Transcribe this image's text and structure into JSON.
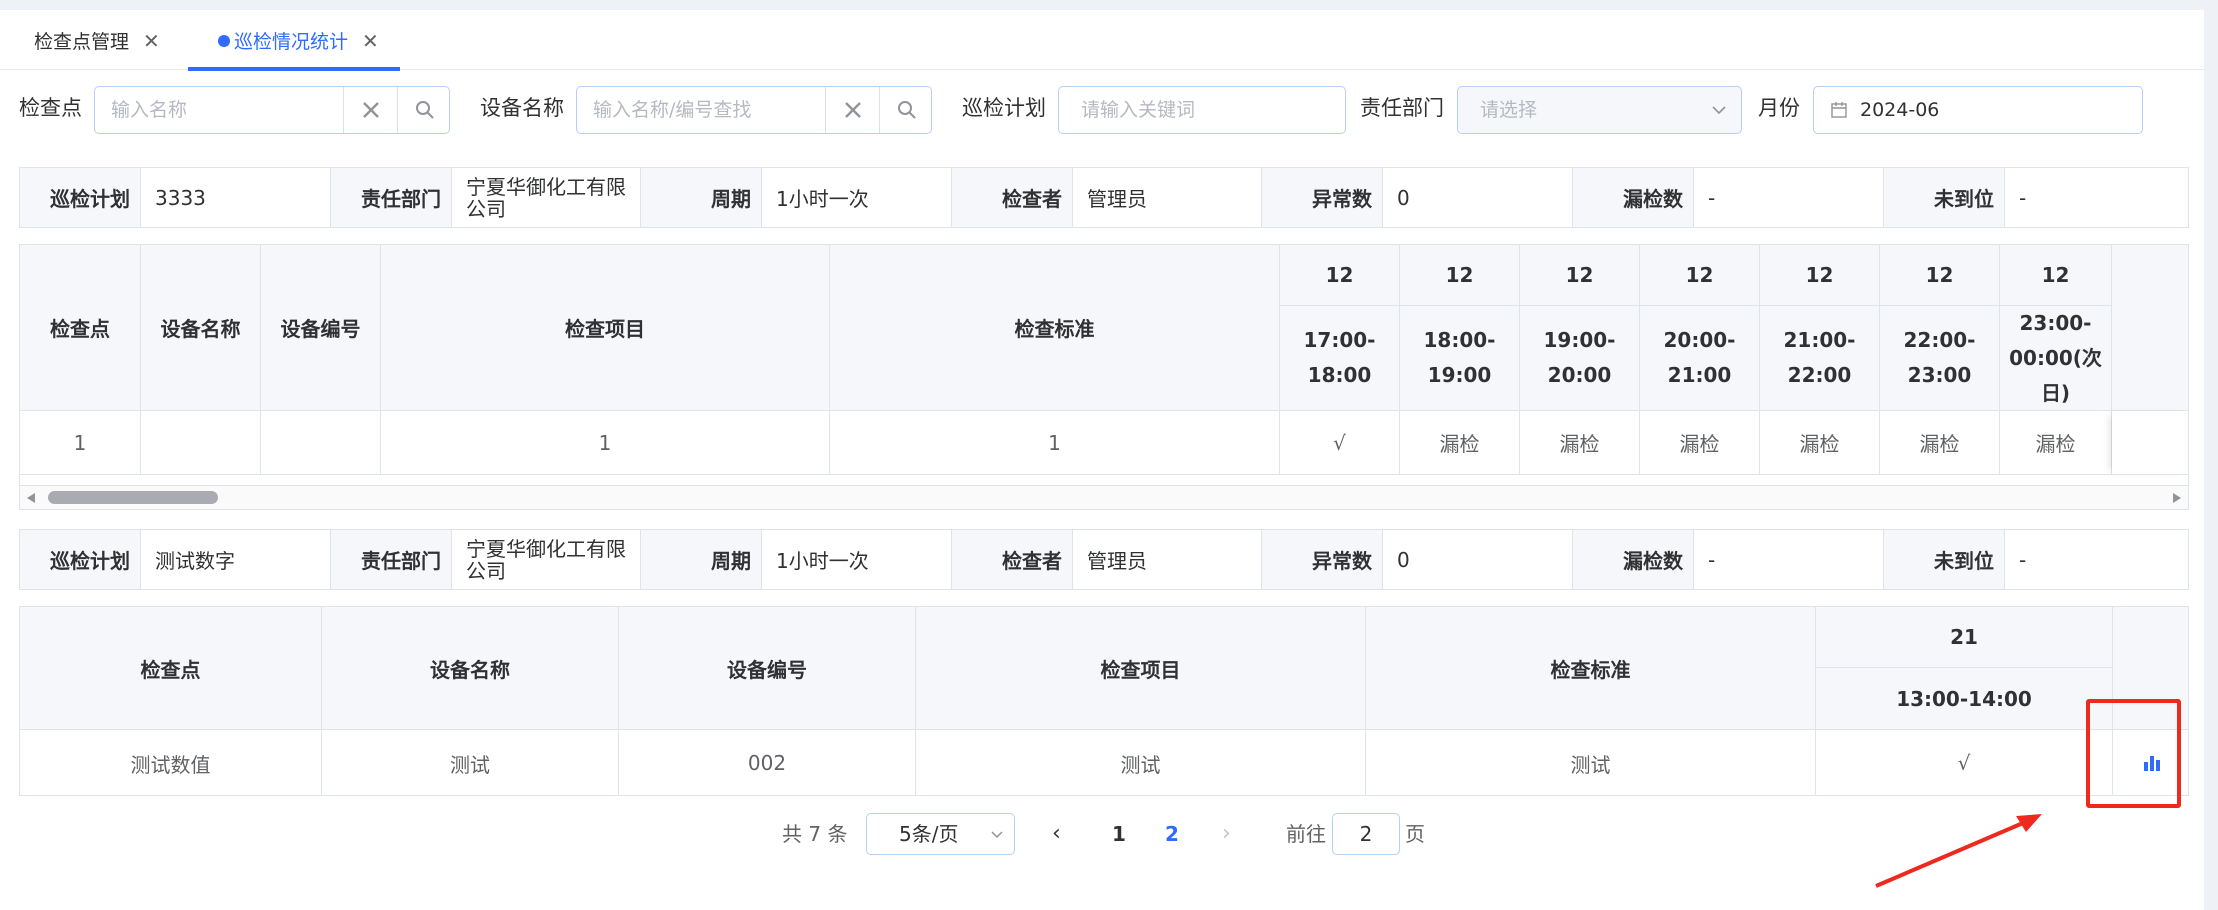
{
  "tabs": [
    {
      "label": "检查点管理",
      "active": false
    },
    {
      "label": "巡检情况统计",
      "active": true
    }
  ],
  "filters": {
    "checkpoint": {
      "label": "检查点",
      "placeholder": "输入名称"
    },
    "device": {
      "label": "设备名称",
      "placeholder": "输入名称/编号查找"
    },
    "plan": {
      "label": "巡检计划",
      "placeholder": "请输入关键词"
    },
    "dept": {
      "label": "责任部门",
      "placeholder": "请选择"
    },
    "month": {
      "label": "月份",
      "value": "2024-06"
    }
  },
  "info_labels": {
    "plan": "巡检计划",
    "dept": "责任部门",
    "period": "周期",
    "inspector": "检查者",
    "abnormal": "异常数",
    "missed": "漏检数",
    "absent": "未到位"
  },
  "plans": [
    {
      "plan": "3333",
      "dept": "宁夏华御化工有限公司",
      "period": "1小时一次",
      "inspector": "管理员",
      "abnormal": "0",
      "missed": "-",
      "absent": "-"
    },
    {
      "plan": "测试数字",
      "dept": "宁夏华御化工有限公司",
      "period": "1小时一次",
      "inspector": "管理员",
      "abnormal": "0",
      "missed": "-",
      "absent": "-"
    }
  ],
  "table_headers": {
    "checkpoint": "检查点",
    "device_name": "设备名称",
    "device_code": "设备编号",
    "item": "检查项目",
    "standard": "检查标准"
  },
  "table1": {
    "slots": [
      {
        "day": "12",
        "time": "17:00-18:00",
        "value": "√"
      },
      {
        "day": "12",
        "time": "18:00-19:00",
        "value": "漏检"
      },
      {
        "day": "12",
        "time": "19:00-20:00",
        "value": "漏检"
      },
      {
        "day": "12",
        "time": "20:00-21:00",
        "value": "漏检"
      },
      {
        "day": "12",
        "time": "21:00-22:00",
        "value": "漏检"
      },
      {
        "day": "12",
        "time": "22:00-23:00",
        "value": "漏检"
      },
      {
        "day": "12",
        "time": "23:00-00:00(次日)",
        "value": "漏检"
      }
    ],
    "row": {
      "checkpoint": "1",
      "device_name": "",
      "device_code": "",
      "item": "1",
      "standard": "1"
    }
  },
  "table2": {
    "slot": {
      "day": "21",
      "time": "13:00-14:00",
      "value": "√"
    },
    "row": {
      "checkpoint": "测试数值",
      "device_name": "测试",
      "device_code": "002",
      "item": "测试",
      "standard": "测试"
    }
  },
  "pagination": {
    "total": "共 7 条",
    "page_size": "5条/页",
    "pages": [
      "1",
      "2"
    ],
    "current": "2",
    "goto_label": "前往",
    "goto_value": "2",
    "page_suffix": "页"
  },
  "colors": {
    "primary": "#2f6bff",
    "highlight": "#ee2a1e"
  }
}
